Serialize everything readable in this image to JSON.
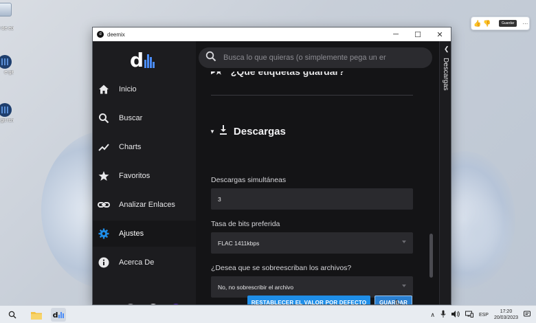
{
  "window": {
    "title": "deemix",
    "controls": {
      "minimize": "─",
      "maximize": "☐",
      "close": "✕"
    }
  },
  "sidebar": {
    "logo_letter": "d",
    "items": [
      {
        "label": "Inicio",
        "icon": "home-icon"
      },
      {
        "label": "Buscar",
        "icon": "search-icon"
      },
      {
        "label": "Charts",
        "icon": "trending-icon"
      },
      {
        "label": "Favoritos",
        "icon": "star-icon"
      },
      {
        "label": "Analizar Enlaces",
        "icon": "link-icon"
      },
      {
        "label": "Ajustes",
        "icon": "gear-icon",
        "active": true
      },
      {
        "label": "Acerca De",
        "icon": "info-icon"
      }
    ],
    "theme_colors": [
      "#1c1c1f",
      "#ffffff",
      "#5b2cc9"
    ]
  },
  "search": {
    "placeholder": "Busca lo que quieras (o simplemente pega un er"
  },
  "settings": {
    "previous_section_title": "¿Qué etiquetas guardar?",
    "section_title": "Descargas",
    "fields": [
      {
        "label": "Descargas simultáneas",
        "value": "3",
        "type": "input"
      },
      {
        "label": "Tasa de bits preferida",
        "value": "FLAC 1411kbps",
        "type": "select"
      },
      {
        "label": "¿Desea que se sobreescriban los archivos?",
        "value": "No, no sobrescribir el archivo",
        "type": "select"
      }
    ],
    "reset_button": "RESTABLECER EL VALOR POR DEFECTO",
    "save_button": "GUARDAR"
  },
  "right_panel": {
    "label": "Descargas"
  },
  "pill": {
    "button": "Guardar"
  },
  "desktop_icons": [
    {
      "label": "",
      "icon": "recycle-bin-icon"
    },
    {
      "label": "er de eb",
      "icon": "shortcut-icon"
    },
    {
      "label": "e-git",
      "icon": "app-icon"
    },
    {
      "label": "e-git rch",
      "icon": "app-icon"
    }
  ],
  "taskbar": {
    "language": "ESP",
    "time": "17:20",
    "date": "20/03/2023"
  },
  "accent_color": "#1f8ee8"
}
